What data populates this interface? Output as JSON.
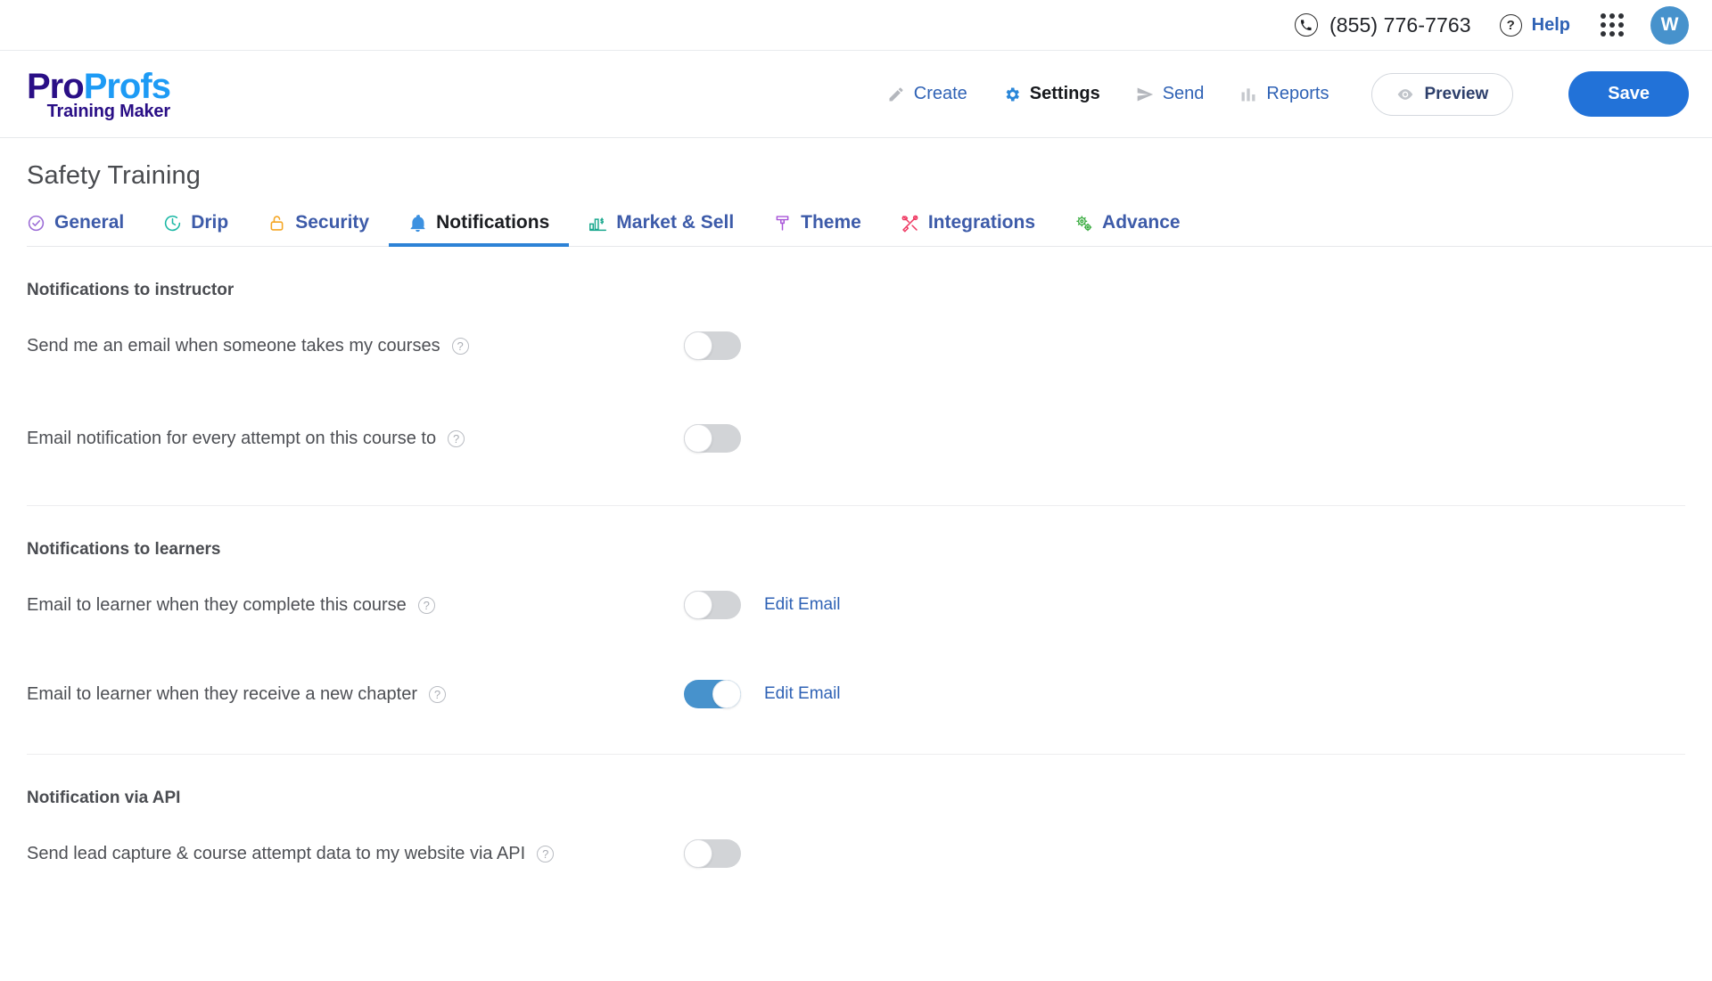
{
  "utility_bar": {
    "phone": "(855) 776-7763",
    "phone_icon": "phone-icon",
    "help_label": "Help",
    "help_icon": "question-circle-icon",
    "apps_icon": "apps-grid-icon",
    "avatar_initial": "W"
  },
  "brand": {
    "logo_pro": "Pro",
    "logo_profs": "Profs",
    "logo_sub": "Training Maker"
  },
  "main_nav": {
    "items": [
      {
        "label": "Create",
        "icon": "pencil-icon",
        "active": false
      },
      {
        "label": "Settings",
        "icon": "gear-icon",
        "active": true
      },
      {
        "label": "Send",
        "icon": "send-icon",
        "active": false
      },
      {
        "label": "Reports",
        "icon": "bar-chart-icon",
        "active": false
      }
    ],
    "preview_label": "Preview",
    "preview_icon": "eye-icon",
    "save_label": "Save"
  },
  "page": {
    "title": "Safety Training"
  },
  "tabs": [
    {
      "label": "General",
      "icon": "check-circle-icon",
      "active": false
    },
    {
      "label": "Drip",
      "icon": "clock-icon",
      "active": false
    },
    {
      "label": "Security",
      "icon": "lock-icon",
      "active": false
    },
    {
      "label": "Notifications",
      "icon": "bell-icon",
      "active": true
    },
    {
      "label": "Market & Sell",
      "icon": "chart-dollar-icon",
      "active": false
    },
    {
      "label": "Theme",
      "icon": "paint-brush-icon",
      "active": false
    },
    {
      "label": "Integrations",
      "icon": "tools-icon",
      "active": false
    },
    {
      "label": "Advance",
      "icon": "gears-icon",
      "active": false
    }
  ],
  "sections": [
    {
      "heading": "Notifications to instructor",
      "rows": [
        {
          "label": "Send me an email when someone takes my courses",
          "help_icon": "question-icon",
          "toggle_state": "off",
          "edit_link": null
        },
        {
          "label": "Email notification for every attempt on this course to",
          "help_icon": "question-icon",
          "toggle_state": "off",
          "edit_link": null
        }
      ]
    },
    {
      "heading": "Notifications to learners",
      "rows": [
        {
          "label": "Email to learner when they complete this course",
          "help_icon": "question-icon",
          "toggle_state": "off",
          "edit_link": "Edit Email"
        },
        {
          "label": "Email to learner when they receive a new chapter",
          "help_icon": "question-icon",
          "toggle_state": "on",
          "edit_link": "Edit Email"
        }
      ]
    },
    {
      "heading": "Notification via API",
      "rows": [
        {
          "label": "Send lead capture & course attempt data to my website via API",
          "help_icon": "question-icon",
          "toggle_state": "off",
          "edit_link": null
        }
      ]
    }
  ],
  "colors": {
    "accent_blue": "#2272d8",
    "link_blue": "#2f62b5",
    "toggle_on": "#4792cc",
    "toggle_off": "#d2d4d7",
    "tab_underline": "#2d82d6",
    "logo_navy": "#2a0f86",
    "logo_blue": "#1d9bf5",
    "avatar_bg": "#4792cc"
  }
}
